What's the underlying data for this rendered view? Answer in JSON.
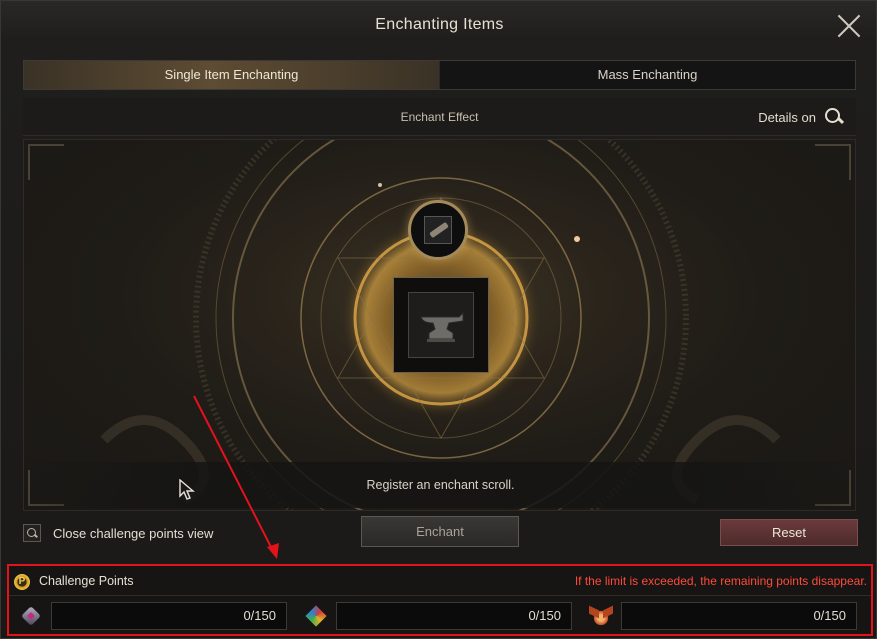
{
  "window": {
    "title": "Enchanting Items",
    "close_icon": "close-icon"
  },
  "tabs": [
    {
      "label": "Single Item Enchanting",
      "active": true
    },
    {
      "label": "Mass Enchanting",
      "active": false
    }
  ],
  "effect_bar": {
    "label": "Enchant Effect",
    "details_label": "Details on",
    "details_icon": "search-icon"
  },
  "stage": {
    "scroll_slot_icon": "enchant-scroll-icon",
    "item_slot_icon": "anvil-icon",
    "register_message": "Register an enchant scroll."
  },
  "controls": {
    "toggle_label": "Close challenge points view",
    "toggle_icon": "magnifier-icon",
    "enchant_label": "Enchant",
    "reset_label": "Reset"
  },
  "challenge_points": {
    "title": "Challenge Points",
    "icon_letter": "P",
    "warning": "If the limit is exceeded, the remaining points disappear.",
    "warning_color": "#ff4a3a",
    "entries": [
      {
        "icon": "gem-icon",
        "value": "0/150"
      },
      {
        "icon": "crystal-icon",
        "value": "0/150"
      },
      {
        "icon": "wings-icon",
        "value": "0/150"
      }
    ]
  },
  "annotation": {
    "highlight_color": "#e3121b"
  }
}
